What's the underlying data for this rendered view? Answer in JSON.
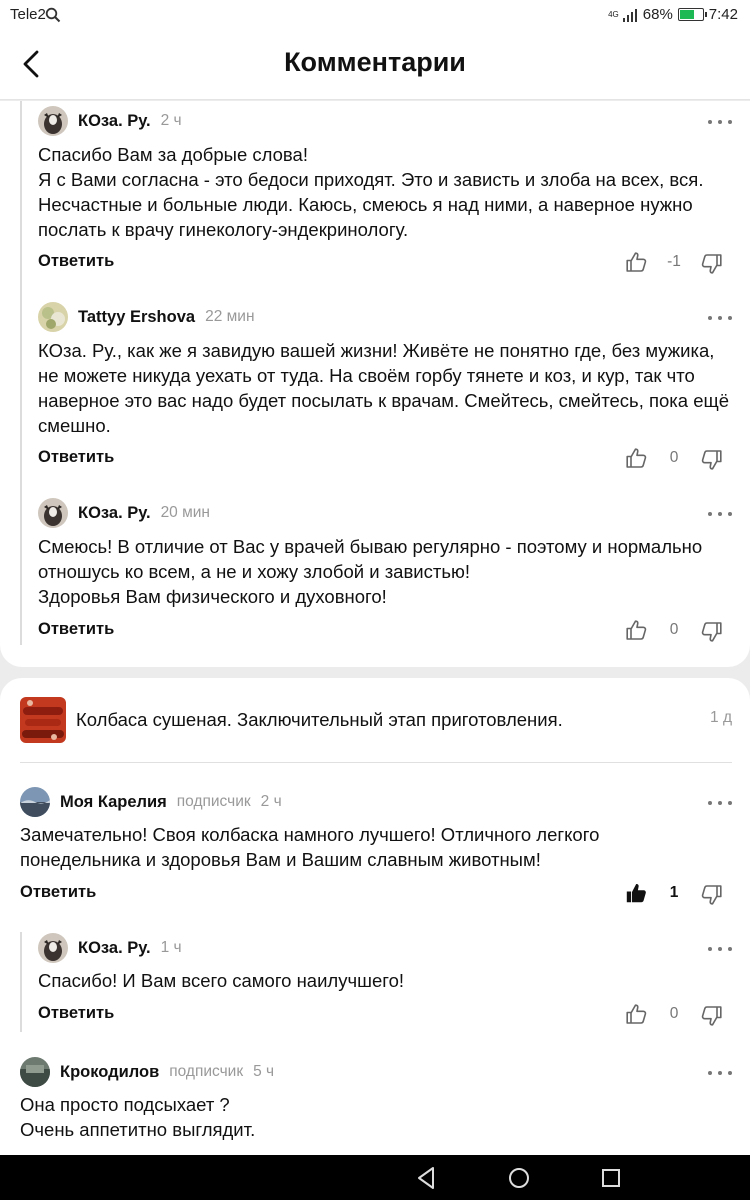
{
  "status": {
    "carrier": "Tele2",
    "net": "4G",
    "battery": "68%",
    "battery_level": 0.68,
    "time": "7:42"
  },
  "header": {
    "title": "Комментарии"
  },
  "thread1": [
    {
      "author": "КОза. Ру.",
      "time": "2 ч",
      "text": "Спасибо Вам за добрые слова!\nЯ с Вами согласна - это бедоси приходят. Это и зависть и злоба на всех, вся. Несчастные и больные люди. Каюсь, смеюсь я над ними, а наверное нужно послать к врачу гинекологу-эндекринологу.",
      "reply": "Ответить",
      "score": "-1"
    },
    {
      "author": "Tattyy Ershova",
      "time": "22 мин",
      "text": "КОза. Ру., как же я завидую вашей жизни! Живёте не понятно где, без мужика, не можете никуда уехать от туда. На своём горбу тянете и коз, и кур, так что наверное это вас надо будет посылать к врачам. Смейтесь, смейтесь, пока ещё смешно.",
      "reply": "Ответить",
      "score": "0"
    },
    {
      "author": "КОза. Ру.",
      "time": "20 мин",
      "text": "Смеюсь! В отличие от Вас у врачей бываю регулярно - поэтому и нормально отношусь ко всем, а не и хожу злобой и завистью!\nЗдоровья Вам физического и духовного!",
      "reply": "Ответить",
      "score": "0"
    }
  ],
  "post": {
    "title": "Колбаса сушеная. Заключительный этап приготовления.",
    "time": "1 д"
  },
  "thread2": [
    {
      "author": "Моя Карелия",
      "role": "подписчик",
      "time": "2 ч",
      "text": "Замечательно! Своя колбаска намного лучшего! Отличного легкого понедельника и здоровья Вам и Вашим славным животным!",
      "reply": "Ответить",
      "score": "1"
    },
    {
      "author": "КОза. Ру.",
      "time": "1 ч",
      "text": "Спасибо! И Вам всего самого наилучшего!",
      "reply": "Ответить",
      "score": "0"
    },
    {
      "author": "Крокодилов",
      "role": "подписчик",
      "time": "5 ч",
      "text": "Она просто подсыхает ?\nОчень аппетитно выглядит."
    }
  ],
  "icons": {
    "back": "chevron-left-icon",
    "like": "thumbs-up-outline-icon",
    "liked": "thumbs-up-filled-icon",
    "dislike": "thumbs-down-outline-icon",
    "more": "more-horizontal-icon",
    "nav": [
      "nav-back-icon",
      "nav-home-icon",
      "nav-recents-icon"
    ]
  },
  "colors": {
    "battery": "#1db954",
    "muted": "#999999",
    "background": "#ececec"
  }
}
